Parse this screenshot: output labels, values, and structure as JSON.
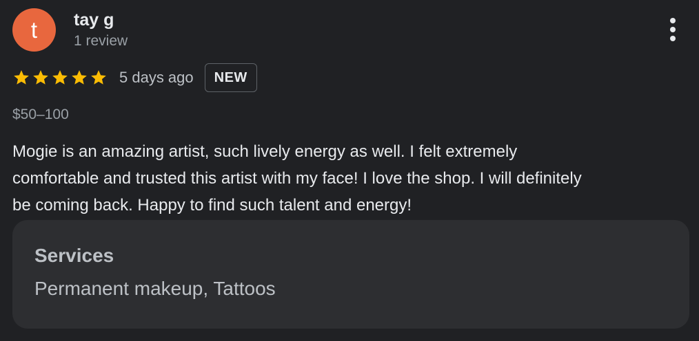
{
  "review": {
    "author": {
      "initial": "t",
      "name": "tay g",
      "meta": "1 review",
      "avatar_color": "#e8673e"
    },
    "more_icon": "more-vert-icon",
    "rating": 5,
    "rating_max": 5,
    "star_color": "#fbbc04",
    "date": "5 days ago",
    "badge": "NEW",
    "price": "$50–100",
    "text": "Mogie is an amazing artist, such lively energy as well. I felt extremely\ncomfortable and trusted this artist with my face! I love the shop. I will definitely\nbe coming back. Happy to find such talent and energy!",
    "services": {
      "title": "Services",
      "value": "Permanent makeup, Tattoos"
    }
  }
}
